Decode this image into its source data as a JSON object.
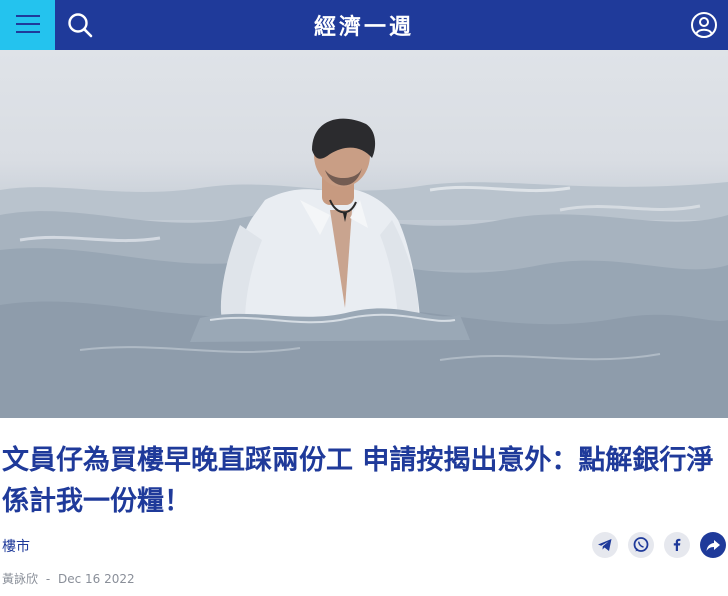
{
  "header": {
    "brand": "經濟一週",
    "menu_icon": "hamburger-menu-icon",
    "search_icon": "search-icon",
    "account_icon": "user-account-icon",
    "bar_color": "#1f3a9a",
    "menu_color": "#24c3ee"
  },
  "hero_image": {
    "subject": "man in white shirt wading in the sea"
  },
  "article": {
    "title": "文員仔為買樓早晚直踩兩份工 申請按揭出意外：點解銀行淨係計我一份糧！",
    "category": "樓市",
    "author": "黃詠欣",
    "separator": "-",
    "date": "Dec 16 2022"
  },
  "share": {
    "icons": [
      "telegram-icon",
      "whatsapp-icon",
      "facebook-icon",
      "share-more-icon"
    ]
  }
}
